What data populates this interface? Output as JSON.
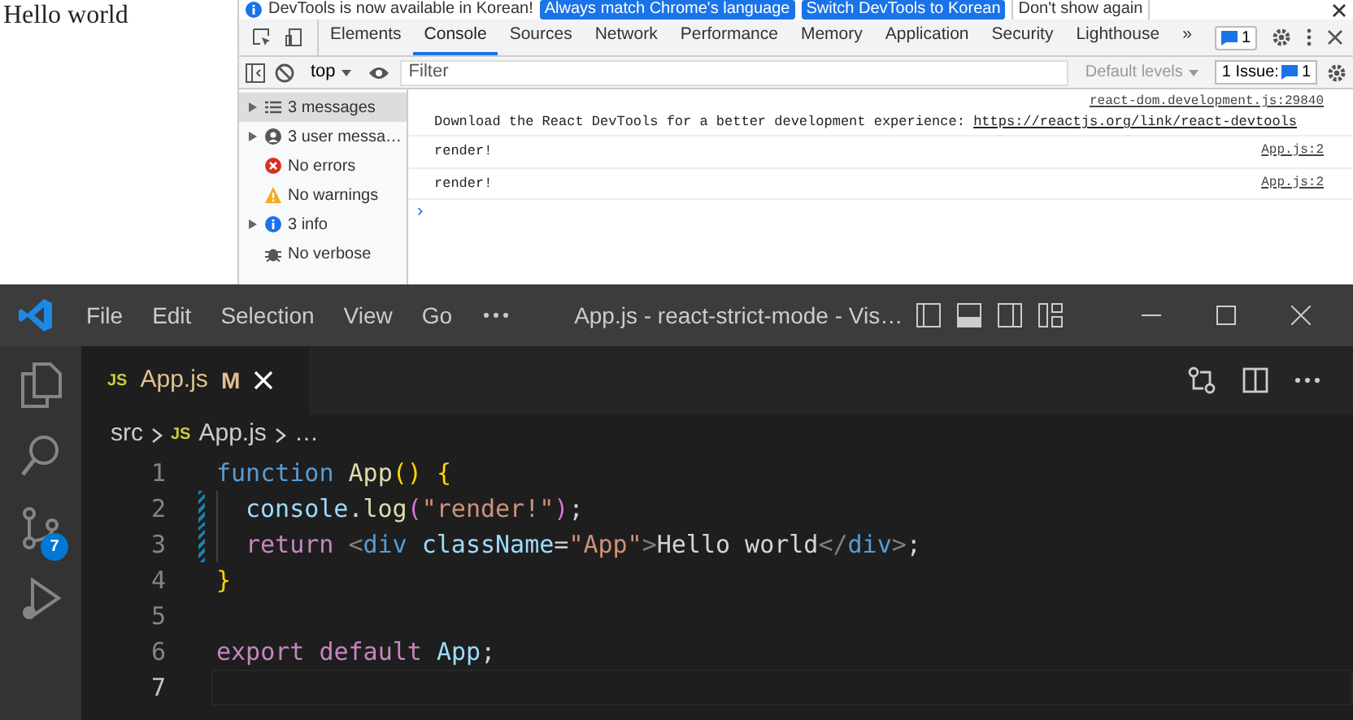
{
  "page": {
    "text": "Hello world"
  },
  "devtools": {
    "infobar": {
      "message": "DevTools is now available in Korean!",
      "buttons": [
        {
          "label": "Always match Chrome's language",
          "kind": "primary"
        },
        {
          "label": "Switch DevTools to Korean",
          "kind": "primary"
        },
        {
          "label": "Don't show again",
          "kind": "secondary"
        }
      ]
    },
    "tabs": [
      {
        "label": "Elements",
        "selected": false
      },
      {
        "label": "Console",
        "selected": true
      },
      {
        "label": "Sources",
        "selected": false
      },
      {
        "label": "Network",
        "selected": false
      },
      {
        "label": "Performance",
        "selected": false
      },
      {
        "label": "Memory",
        "selected": false
      },
      {
        "label": "Application",
        "selected": false
      },
      {
        "label": "Security",
        "selected": false
      },
      {
        "label": "Lighthouse",
        "selected": false
      }
    ],
    "more_tabs": "»",
    "messages_badge": "1",
    "toolbar": {
      "context": "top",
      "filter_placeholder": "Filter",
      "levels": "Default levels",
      "issues_label": "1 Issue:",
      "issues_count": "1"
    },
    "sidebar": [
      {
        "label": "3 messages",
        "kind": "list",
        "expandable": true,
        "selected": true
      },
      {
        "label": "3 user messa…",
        "kind": "user",
        "expandable": true,
        "selected": false
      },
      {
        "label": "No errors",
        "kind": "error",
        "expandable": false,
        "selected": false
      },
      {
        "label": "No warnings",
        "kind": "warning",
        "expandable": false,
        "selected": false
      },
      {
        "label": "3 info",
        "kind": "info",
        "expandable": true,
        "selected": false
      },
      {
        "label": "No verbose",
        "kind": "verbose",
        "expandable": false,
        "selected": false
      }
    ],
    "messages": [
      {
        "source": "react-dom.development.js:29840",
        "text": "Download the React DevTools for a better development experience: ",
        "link": "https://reactjs.org/link/react-devtools"
      },
      {
        "source": "App.js:2",
        "text": "render!"
      },
      {
        "source": "App.js:2",
        "text": "render!"
      }
    ],
    "prompt": "›"
  },
  "vscode": {
    "menu": [
      "File",
      "Edit",
      "Selection",
      "View",
      "Go"
    ],
    "title": "App.js - react-strict-mode - Vis…",
    "source_control_badge": "7",
    "tab": {
      "file_icon": "JS",
      "label": "App.js",
      "status": "M"
    },
    "breadcrumbs": [
      {
        "label": "src"
      },
      {
        "file_icon": "JS",
        "label": "App.js"
      },
      {
        "label": "…"
      }
    ],
    "lines": [
      {
        "number": "1",
        "active": false,
        "modified": false,
        "indented": false,
        "segments": [
          {
            "kind": "keyword",
            "text": "function "
          },
          {
            "kind": "function",
            "text": "App"
          },
          {
            "kind": "bracket",
            "text": "() {"
          }
        ]
      },
      {
        "number": "2",
        "active": false,
        "modified": true,
        "indented": true,
        "segments": [
          {
            "kind": "variable",
            "text": "console"
          },
          {
            "kind": "plain",
            "text": "."
          },
          {
            "kind": "function",
            "text": "log"
          },
          {
            "kind": "bracket2",
            "text": "("
          },
          {
            "kind": "string",
            "text": "\"render!\""
          },
          {
            "kind": "bracket2",
            "text": ")"
          },
          {
            "kind": "plain",
            "text": ";"
          }
        ]
      },
      {
        "number": "3",
        "active": false,
        "modified": true,
        "indented": true,
        "segments": [
          {
            "kind": "control",
            "text": "return "
          },
          {
            "kind": "tag",
            "text": "<"
          },
          {
            "kind": "keyword",
            "text": "div "
          },
          {
            "kind": "variable",
            "text": "className"
          },
          {
            "kind": "plain",
            "text": "="
          },
          {
            "kind": "string",
            "text": "\"App\""
          },
          {
            "kind": "tag",
            "text": ">"
          },
          {
            "kind": "plain",
            "text": "Hello world"
          },
          {
            "kind": "tag",
            "text": "</"
          },
          {
            "kind": "keyword",
            "text": "div"
          },
          {
            "kind": "tag",
            "text": ">"
          },
          {
            "kind": "plain",
            "text": ";"
          }
        ]
      },
      {
        "number": "4",
        "active": false,
        "modified": false,
        "indented": false,
        "segments": [
          {
            "kind": "bracket",
            "text": "}"
          }
        ]
      },
      {
        "number": "5",
        "active": false,
        "modified": false,
        "indented": false
      },
      {
        "number": "6",
        "active": false,
        "modified": false,
        "indented": false,
        "segments": [
          {
            "kind": "control",
            "text": "export default "
          },
          {
            "kind": "variable",
            "text": "App"
          },
          {
            "kind": "plain",
            "text": ";"
          }
        ]
      },
      {
        "number": "7",
        "active": true,
        "modified": false,
        "indented": false
      }
    ]
  }
}
